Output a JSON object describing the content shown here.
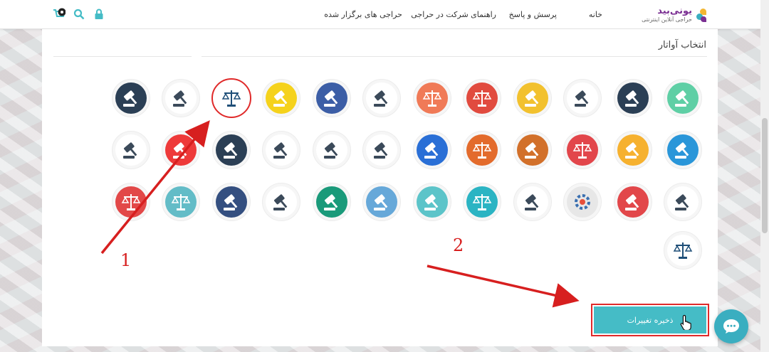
{
  "header": {
    "logo_title": "یونی‌بید",
    "logo_subtitle": "حراجی آنلاین اینترنتی",
    "nav": [
      {
        "label": "خانه"
      },
      {
        "label": "پرسش و پاسخ"
      },
      {
        "label": "راهنمای شرکت در حراجی"
      },
      {
        "label": "حراجی های برگزار شده"
      }
    ],
    "icons": [
      "lock-icon",
      "search-icon",
      "bid-icon",
      "cart-icon"
    ]
  },
  "section": {
    "title": "انتخاب آواتار"
  },
  "avatars": [
    {
      "bg": "#5fcfa5",
      "icon": "gavel"
    },
    {
      "bg": "#2b3f55",
      "icon": "gavel"
    },
    {
      "bg": "#ffffff",
      "icon": "gavel"
    },
    {
      "bg": "#f2c12e",
      "icon": "gavel"
    },
    {
      "bg": "#e14b3f",
      "icon": "scales"
    },
    {
      "bg": "#f07a57",
      "icon": "scales"
    },
    {
      "bg": "#ffffff",
      "icon": "gavel"
    },
    {
      "bg": "#3c5ea6",
      "icon": "gavel"
    },
    {
      "bg": "#f5d21c",
      "icon": "gavel"
    },
    {
      "bg": "#ffffff",
      "icon": "scales",
      "selected": true
    },
    {
      "bg": "#ffffff",
      "icon": "gavel"
    },
    {
      "bg": "#2b3f55",
      "icon": "gavel"
    },
    {
      "bg": "#2a96d9",
      "icon": "gavel"
    },
    {
      "bg": "#f6b12f",
      "icon": "gavel"
    },
    {
      "bg": "#e2464b",
      "icon": "scales"
    },
    {
      "bg": "#d2702a",
      "icon": "gavel"
    },
    {
      "bg": "#e36b2c",
      "icon": "scales"
    },
    {
      "bg": "#2a6fd6",
      "icon": "gavel"
    },
    {
      "bg": "#ffffff",
      "icon": "gavel"
    },
    {
      "bg": "#ffffff",
      "icon": "gavel"
    },
    {
      "bg": "#ffffff",
      "icon": "gavel"
    },
    {
      "bg": "#2b3f55",
      "icon": "gavel"
    },
    {
      "bg": "#ee3a3a",
      "icon": "gavel"
    },
    {
      "bg": "#ffffff",
      "icon": "gavel"
    },
    {
      "bg": "#ffffff",
      "icon": "gavel"
    },
    {
      "bg": "#e2474a",
      "icon": "gavel"
    },
    {
      "bg": "#e7e7e7",
      "icon": "gear"
    },
    {
      "bg": "#ffffff",
      "icon": "gavel"
    },
    {
      "bg": "#2bb4c3",
      "icon": "scales"
    },
    {
      "bg": "#5cc4c9",
      "icon": "gavel"
    },
    {
      "bg": "#66a8d9",
      "icon": "gavel"
    },
    {
      "bg": "#1a9a7a",
      "icon": "gavel"
    },
    {
      "bg": "#ffffff",
      "icon": "gavel"
    },
    {
      "bg": "#344f80",
      "icon": "gavel"
    },
    {
      "bg": "#63bcc7",
      "icon": "scales"
    },
    {
      "bg": "#e24848",
      "icon": "scales"
    },
    {
      "bg": "#ffffff",
      "icon": "scales"
    }
  ],
  "save_button": {
    "label": "ذخیره تغییرات"
  },
  "annotations": {
    "one": "1",
    "two": "2"
  },
  "colors": {
    "accent": "#45bcc6",
    "highlight": "#e02a2a",
    "brand": "#7a2f92"
  }
}
